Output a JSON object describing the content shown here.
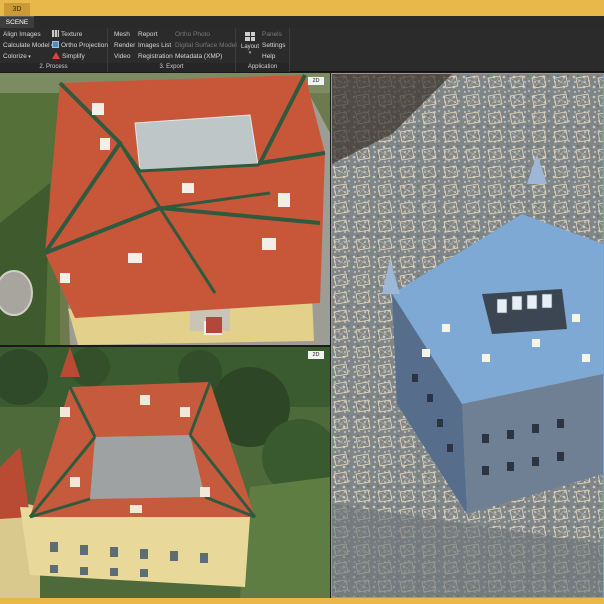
{
  "titlebar": {
    "tab_label": "3D"
  },
  "tabstrip": {
    "active_tab": "SCENE"
  },
  "ribbon": {
    "process": {
      "label": "2. Process",
      "items": [
        "Align Images",
        "Calculate Model",
        "Colorize",
        "Texture",
        "Ortho Projection",
        "Simplify"
      ]
    },
    "export": {
      "label": "3. Export",
      "items": [
        "Mesh",
        "Render",
        "Video",
        "Report",
        "Images List",
        "Registration",
        "Ortho Photo",
        "Digital Surface Model",
        "Metadata (XMP)"
      ]
    },
    "application": {
      "label": "Application",
      "layout_label": "Layout",
      "items": [
        "Panels",
        "Settings",
        "Help"
      ]
    }
  },
  "viewports": {
    "top_left_tag": "2D",
    "bottom_left_tag": "2D"
  },
  "colors": {
    "accent": "#e8b84a",
    "ribbon_bg": "#2b2b2b",
    "roof": "#c4573a",
    "roof_trim": "#2f5a3e",
    "facade": "#e6d79a",
    "grass": "#4d6b35",
    "selection": "#6ea3d8"
  }
}
